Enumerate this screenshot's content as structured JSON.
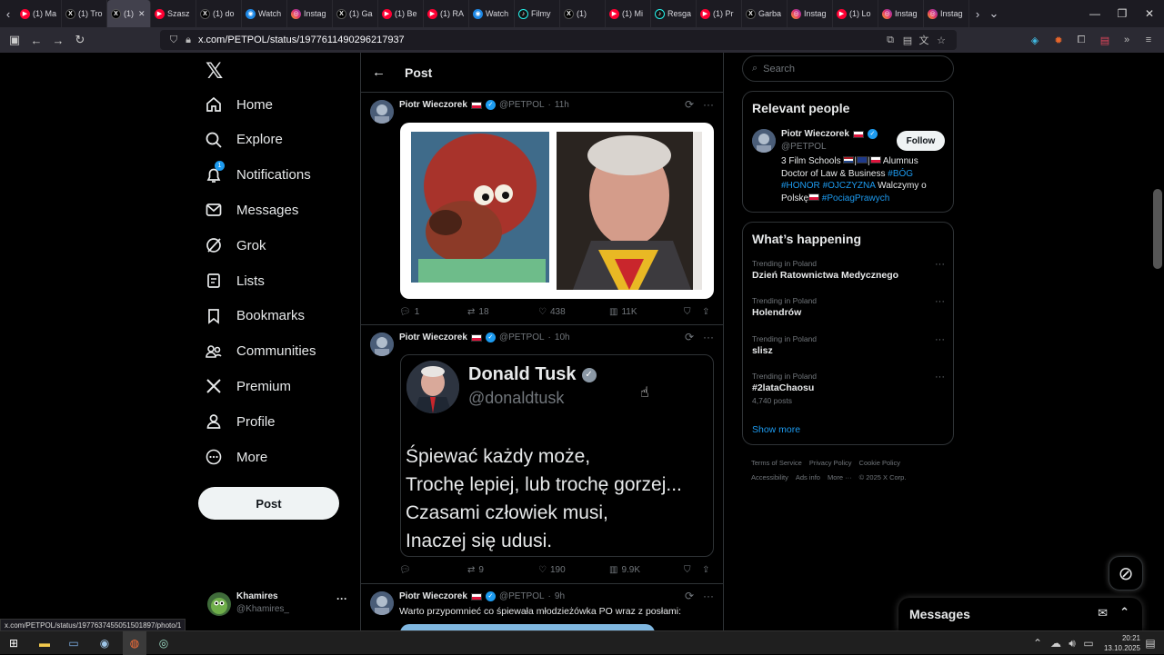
{
  "browser": {
    "tabs": [
      {
        "icon": "youtube-icon",
        "label": "(1) Ma"
      },
      {
        "icon": "x-icon",
        "label": "(1) Tro"
      },
      {
        "icon": "x-icon",
        "label": "(1)",
        "active": true
      },
      {
        "icon": "youtube-icon",
        "label": "Szasz"
      },
      {
        "icon": "x-icon",
        "label": "(1) do"
      },
      {
        "icon": "watch-icon",
        "label": "Watch"
      },
      {
        "icon": "instagram-icon",
        "label": "Instag"
      },
      {
        "icon": "x-icon",
        "label": "(1) Ga"
      },
      {
        "icon": "youtube-icon",
        "label": "(1) Be"
      },
      {
        "icon": "youtube-icon",
        "label": "(1) RA"
      },
      {
        "icon": "watch-icon",
        "label": "Watch"
      },
      {
        "icon": "tiktok-icon",
        "label": "Filmy"
      },
      {
        "icon": "x-icon",
        "label": "(1)"
      },
      {
        "icon": "youtube-icon",
        "label": "(1) Mi"
      },
      {
        "icon": "tiktok-icon",
        "label": "Resga"
      },
      {
        "icon": "youtube-icon",
        "label": "(1) Pr"
      },
      {
        "icon": "x-icon",
        "label": "Garba"
      },
      {
        "icon": "instagram-icon",
        "label": "Instag"
      },
      {
        "icon": "youtube-icon",
        "label": "(1) Lo"
      },
      {
        "icon": "instagram-icon",
        "label": "Instag"
      },
      {
        "icon": "instagram-icon",
        "label": "Instag"
      }
    ],
    "url": "x.com/PETPOL/status/1977611490296217937",
    "status_link": "x.com/PETPOL/status/1977637455051501897/photo/1"
  },
  "sidebar": {
    "nav": [
      {
        "icon": "home-icon",
        "label": "Home"
      },
      {
        "icon": "explore-icon",
        "label": "Explore"
      },
      {
        "icon": "notifications-icon",
        "label": "Notifications",
        "badge": "1"
      },
      {
        "icon": "messages-icon",
        "label": "Messages"
      },
      {
        "icon": "grok-icon",
        "label": "Grok"
      },
      {
        "icon": "lists-icon",
        "label": "Lists"
      },
      {
        "icon": "bookmarks-icon",
        "label": "Bookmarks"
      },
      {
        "icon": "communities-icon",
        "label": "Communities"
      },
      {
        "icon": "premium-icon",
        "label": "Premium"
      },
      {
        "icon": "profile-icon",
        "label": "Profile"
      },
      {
        "icon": "more-icon",
        "label": "More"
      }
    ],
    "post_button": "Post",
    "account": {
      "name": "Khamires",
      "handle": "@Khamires_"
    }
  },
  "column": {
    "back_icon": "back-arrow-icon",
    "title": "Post"
  },
  "tweets": [
    {
      "name": "Piotr Wieczorek",
      "handle": "@PETPOL",
      "time": "11h",
      "stats": {
        "replies": "1",
        "reposts": "18",
        "likes": "438",
        "views": "11K"
      }
    },
    {
      "name": "Piotr Wieczorek",
      "handle": "@PETPOL",
      "time": "10h",
      "card": {
        "name": "Donald Tusk",
        "handle": "@donaldtusk",
        "lines": [
          "Śpiewać każdy może,",
          "Trochę lepiej, lub trochę gorzej...",
          "Czasami człowiek musi,",
          "Inaczej się udusi."
        ]
      },
      "stats": {
        "replies": "",
        "reposts": "9",
        "likes": "190",
        "views": "9.9K"
      }
    },
    {
      "name": "Piotr Wieczorek",
      "handle": "@PETPOL",
      "time": "9h",
      "text": "Warto przypomnieć co śpiewała młodzieżówka PO wraz z posłami:"
    }
  ],
  "right": {
    "search_placeholder": "Search",
    "relevant": {
      "title": "Relevant people",
      "name": "Piotr Wieczorek",
      "handle": "@PETPOL",
      "follow": "Follow",
      "bio_1": "3 Film Schools",
      "bio_2": "Alumnus",
      "bio_3": "Doctor of Law & Business",
      "tag_bog": "#BÓG",
      "tag_honor": "#HONOR",
      "tag_ojczyzna": "#OJCZYZNA",
      "bio_4": "Walczymy o",
      "bio_5": "Polskę",
      "tag_pociag": "#PociagPrawych"
    },
    "happening": {
      "title": "What’s happening",
      "trends": [
        {
          "category": "Trending in Poland",
          "name": "Dzień Ratownictwa Medycznego",
          "count": ""
        },
        {
          "category": "Trending in Poland",
          "name": "Holendrów",
          "count": ""
        },
        {
          "category": "Trending in Poland",
          "name": "slisz",
          "count": ""
        },
        {
          "category": "Trending in Poland",
          "name": "#2lataChaosu",
          "count": "4,740 posts"
        }
      ],
      "show_more": "Show more"
    },
    "footer": [
      "Terms of Service",
      "Privacy Policy",
      "Cookie Policy",
      "Accessibility",
      "Ads info",
      "More ···",
      "© 2025 X Corp."
    ]
  },
  "messages_drawer": {
    "title": "Messages"
  },
  "taskbar": {
    "time": "20:21",
    "date": "13.10.2025"
  }
}
